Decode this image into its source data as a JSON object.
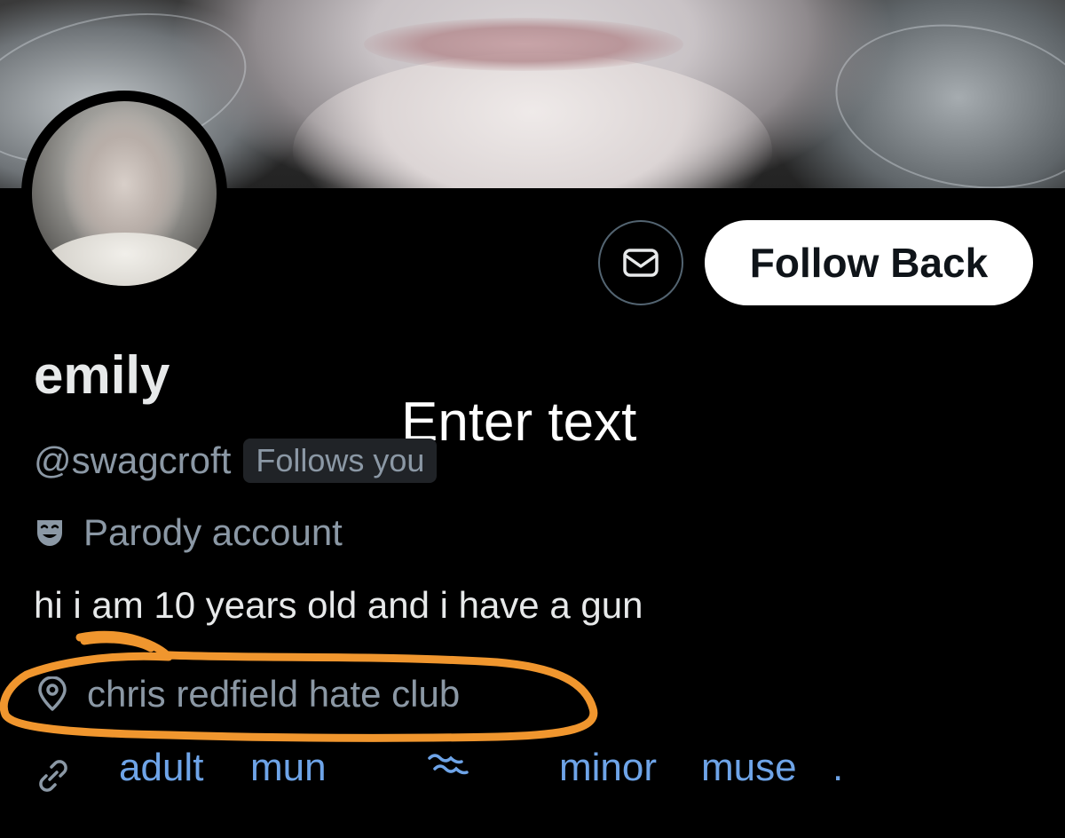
{
  "profile": {
    "display_name": "emily",
    "handle": "@swagcroft",
    "follows_badge": "Follows you",
    "parody_label": "Parody account",
    "bio": "hi i am 10 years old and i have a gun",
    "location": "chris redfield hate club",
    "links": {
      "word1": "adult",
      "word2": "mun",
      "word3": "minor",
      "word4": "muse",
      "word5": "."
    }
  },
  "actions": {
    "message_icon": "envelope-icon",
    "follow_back_label": "Follow Back"
  },
  "overlay": {
    "text": "Enter text"
  },
  "icons": {
    "parody": "theater-mask-icon",
    "location": "location-pin-icon",
    "link": "link-icon",
    "wave": "wave-icon"
  },
  "colors": {
    "background": "#000000",
    "primary_text": "#e7e9ea",
    "secondary_text": "#8b98a5",
    "link": "#6ea4e8",
    "annotation": "#f0962e",
    "button_bg": "#ffffff"
  }
}
